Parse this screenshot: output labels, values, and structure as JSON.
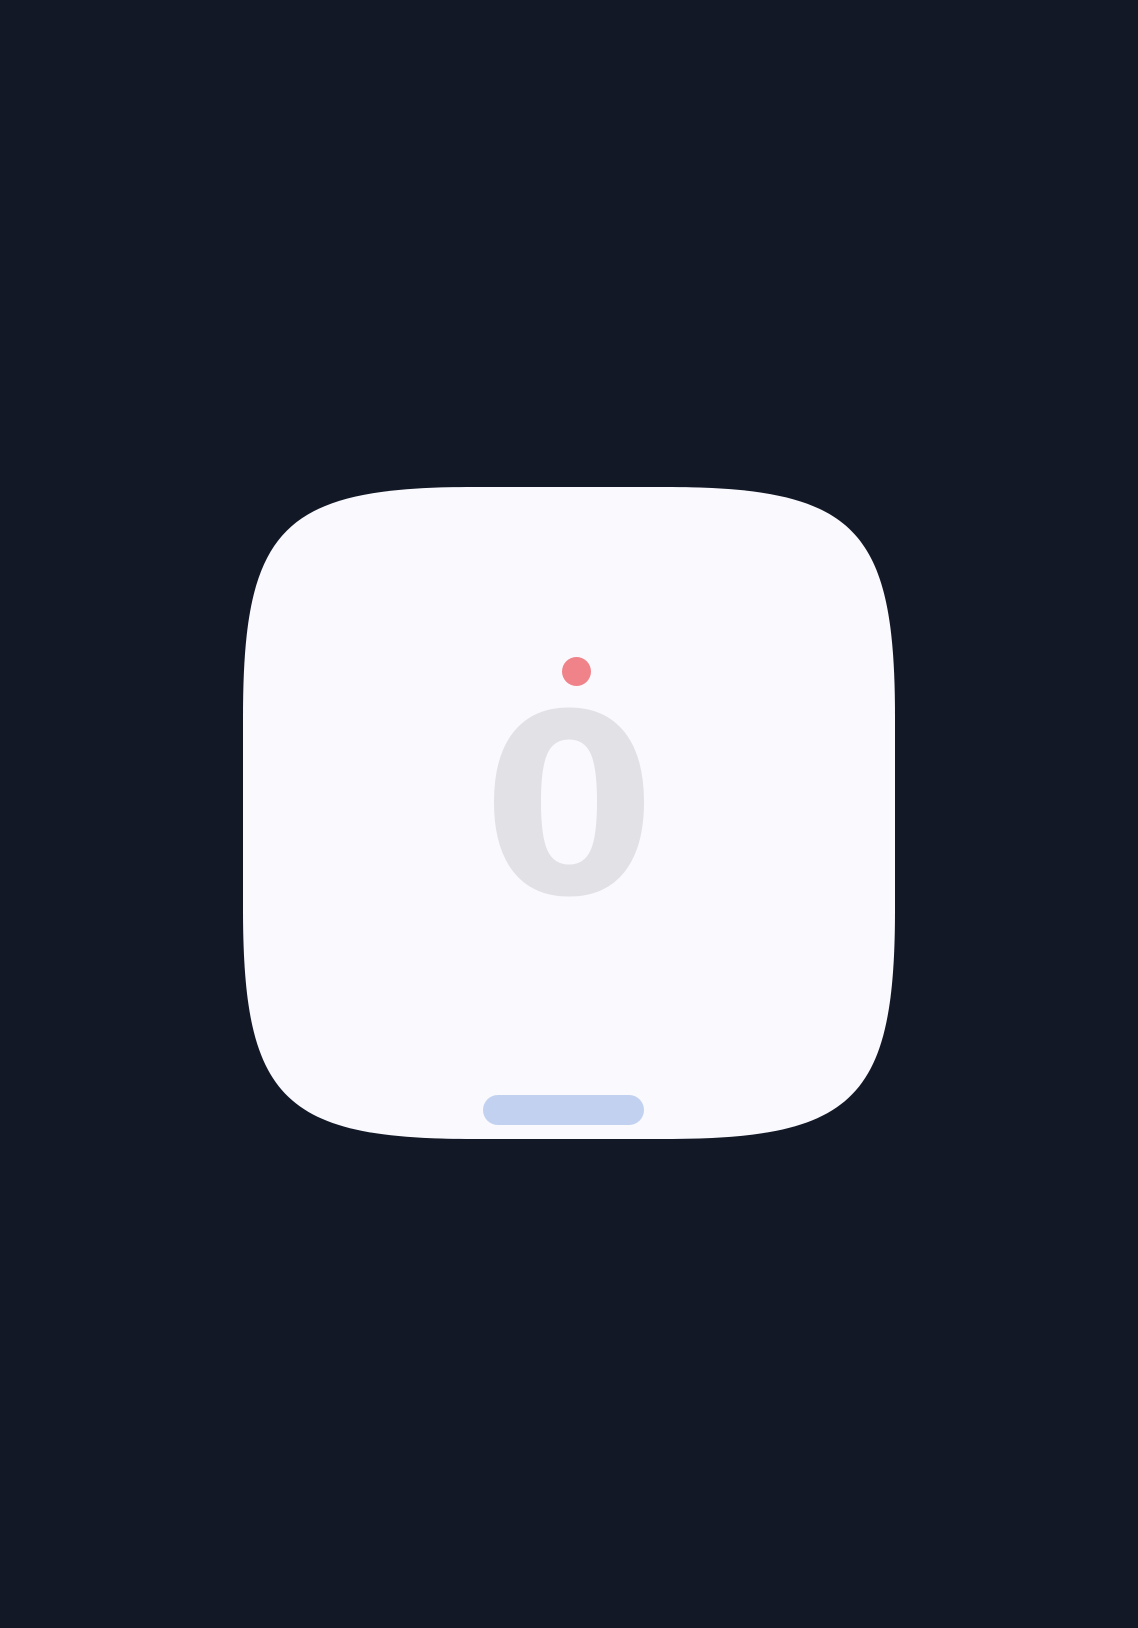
{
  "counter": {
    "value": "0"
  },
  "colors": {
    "background": "#121826",
    "card": "#f9f9fe",
    "digit": "#e1e1e6",
    "indicator_dot": "#f0828a",
    "handle": "#c3d1f1"
  },
  "icons": {
    "indicator": "status-dot-icon",
    "handle": "drag-handle-icon"
  }
}
